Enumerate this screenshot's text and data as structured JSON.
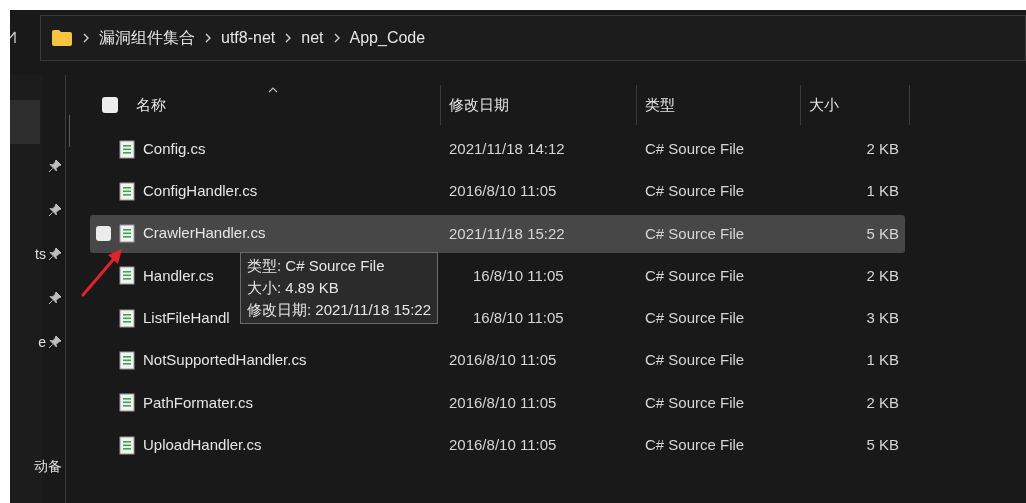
{
  "breadcrumb": [
    "漏洞组件集合",
    "utf8-net",
    "net",
    "App_Code"
  ],
  "nav_pane": {
    "items": [
      {
        "selected": true
      },
      {
        "selected": false
      },
      {
        "selected": false
      },
      {
        "label": "ts",
        "selected": false
      },
      {
        "selected": false
      },
      {
        "label": "e",
        "selected": false
      }
    ],
    "footer": "动备"
  },
  "select_all": {
    "checked": false
  },
  "columns": [
    "名称",
    "修改日期",
    "类型",
    "大小"
  ],
  "rows": [
    {
      "name": "Config.cs",
      "date": "2021/11/18 14:12",
      "type": "C# Source File",
      "size": "2 KB",
      "hovered": false,
      "date_clipped": false
    },
    {
      "name": "ConfigHandler.cs",
      "date": "2016/8/10 11:05",
      "type": "C# Source File",
      "size": "1 KB",
      "hovered": false,
      "date_clipped": false
    },
    {
      "name": "CrawlerHandler.cs",
      "date": "2021/11/18 15:22",
      "type": "C# Source File",
      "size": "5 KB",
      "hovered": true,
      "date_clipped": false
    },
    {
      "name": "Handler.cs",
      "date": "16/8/10 11:05",
      "type": "C# Source File",
      "size": "2 KB",
      "hovered": false,
      "date_clipped": true
    },
    {
      "name": "ListFileHandl",
      "date": "16/8/10 11:05",
      "type": "C# Source File",
      "size": "3 KB",
      "hovered": false,
      "date_clipped": true
    },
    {
      "name": "NotSupportedHandler.cs",
      "date": "2016/8/10 11:05",
      "type": "C# Source File",
      "size": "1 KB",
      "hovered": false,
      "date_clipped": false
    },
    {
      "name": "PathFormater.cs",
      "date": "2016/8/10 11:05",
      "type": "C# Source File",
      "size": "2 KB",
      "hovered": false,
      "date_clipped": false
    },
    {
      "name": "UploadHandler.cs",
      "date": "2016/8/10 11:05",
      "type": "C# Source File",
      "size": "5 KB",
      "hovered": false,
      "date_clipped": false
    }
  ],
  "tooltip": [
    "类型: C# Source File",
    "大小: 4.89 KB",
    "修改日期: 2021/11/18 15:22"
  ]
}
